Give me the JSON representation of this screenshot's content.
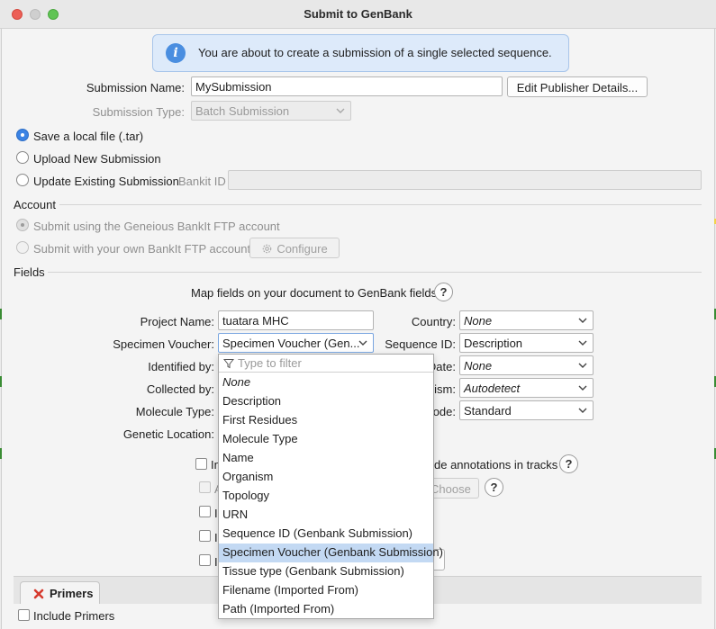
{
  "window": {
    "title": "Submit to GenBank"
  },
  "info": {
    "message": "You are about to create a submission of a single selected sequence."
  },
  "submission": {
    "name_label": "Submission Name:",
    "name_value": "MySubmission",
    "edit_publisher_label": "Edit Publisher Details...",
    "type_label": "Submission Type:",
    "type_value": "Batch Submission"
  },
  "mode_options": [
    {
      "label": "Save a local file (.tar)",
      "selected": true
    },
    {
      "label": "Upload New Submission",
      "selected": false
    },
    {
      "label": "Update Existing Submission",
      "selected": false
    }
  ],
  "bankit": {
    "label": "Bankit ID",
    "value": ""
  },
  "account": {
    "heading": "Account",
    "option_geneious": "Submit using the Geneious BankIt FTP account",
    "option_own": "Submit with your own BankIt FTP account",
    "configure_label": "Configure"
  },
  "fields": {
    "heading": "Fields",
    "map_text": "Map fields on your document to GenBank fields",
    "help": "?",
    "project_name_label": "Project Name:",
    "project_name_value": "tuatara MHC",
    "specimen_voucher_label": "Specimen Voucher:",
    "specimen_voucher_value": "Specimen Voucher (Gen...",
    "identified_by_label": "Identified by:",
    "collected_by_label": "Collected by:",
    "molecule_type_label": "Molecule Type:",
    "genetic_location_label": "Genetic Location:",
    "country_label": "Country:",
    "country_value": "None",
    "sequence_id_label": "Sequence ID:",
    "sequence_id_value": "Description",
    "date_label_partial": "Date:",
    "date_value": "None",
    "organism_label_partial": "ism:",
    "organism_value": "Autodetect",
    "code_label_partial": "ode:",
    "code_value": "Standard",
    "include_annotations_partial": "de annotations in tracks",
    "choose_partial": "Choose",
    "row_prefix_include": "In",
    "row_prefix_a": "A",
    "row_prefix_i": "I"
  },
  "dropdown": {
    "filter_placeholder": "Type to filter",
    "options": [
      "None",
      "Description",
      "First Residues",
      "Molecule Type",
      "Name",
      "Organism",
      "Topology",
      "URN",
      "Sequence ID (Genbank Submission)",
      "Specimen Voucher (Genbank Submission)",
      "Tissue type (Genbank Submission)",
      "Filename (Imported From)",
      "Path (Imported From)"
    ],
    "selected_index": 9
  },
  "primers": {
    "tab_label": "Primers",
    "include_label": "Include Primers"
  },
  "colors": {
    "accent": "#3b83e4",
    "info_bg": "#ddeafa",
    "selection": "#c3d9f3",
    "close_red": "#ec5f57",
    "min_yellow": "#f5be4f",
    "max_green": "#60c454",
    "tab_x_red": "#d63a2e"
  }
}
